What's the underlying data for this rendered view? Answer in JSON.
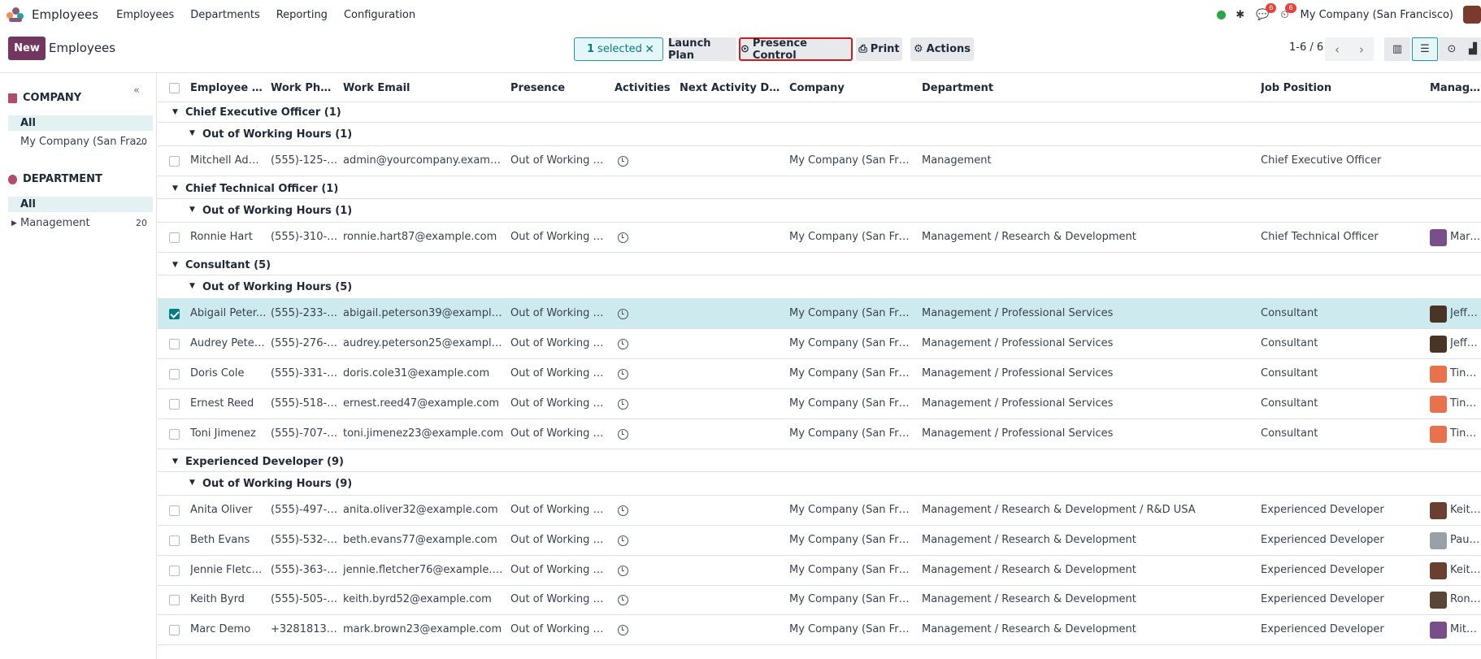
{
  "topbar": {
    "app_name": "Employees",
    "menu": [
      "Employees",
      "Departments",
      "Reporting",
      "Configuration"
    ],
    "badge_messages": "6",
    "badge_activities": "6",
    "company": "My Company (San Francisco)"
  },
  "control": {
    "new_label": "New",
    "breadcrumb": "Employees",
    "selected_count": "1",
    "selected_label": "selected",
    "launch_plan": "Launch Plan",
    "presence_control": "Presence Control",
    "print": "Print",
    "actions": "Actions",
    "pager": "1-6 / 6"
  },
  "sidebar": {
    "company_title": "COMPANY",
    "company_items": [
      {
        "label": "All",
        "count": ""
      },
      {
        "label": "My Company (San Fra...",
        "count": "20"
      }
    ],
    "department_title": "DEPARTMENT",
    "department_items": [
      {
        "label": "All",
        "count": ""
      },
      {
        "label": "Management",
        "count": "20"
      }
    ]
  },
  "table": {
    "headers": [
      "Employee Na...",
      "Work Phone",
      "Work Email",
      "Presence",
      "Activities",
      "Next Activity Dead...",
      "Company",
      "Department",
      "Job Position",
      "Manager"
    ],
    "groups": [
      {
        "label": "Chief Executive Officer (1)",
        "sub": "Out of Working Hours (1)"
      },
      {
        "label": "Chief Technical Officer (1)",
        "sub": "Out of Working Hours (1)"
      },
      {
        "label": "Consultant (5)",
        "sub": "Out of Working Hours (5)"
      },
      {
        "label": "Experienced Developer (9)",
        "sub": "Out of Working Hours (9)"
      }
    ],
    "rows": [
      {
        "name": "Mitchell Admin",
        "phone": "(555)-125-2...",
        "email": "admin@yourcompany.example....",
        "presence": "Out of Working H...",
        "company": "My Company (San Franci...",
        "dept": "Management",
        "job": "Chief Executive Officer",
        "manager": ""
      },
      {
        "name": "Ronnie Hart",
        "phone": "(555)-310-7...",
        "email": "ronnie.hart87@example.com",
        "presence": "Out of Working H...",
        "company": "My Company (San Franci...",
        "dept": "Management / Research & Development",
        "job": "Chief Technical Officer",
        "manager": "Marc D"
      },
      {
        "name": "Abigail Peter...",
        "phone": "(555)-233-3...",
        "email": "abigail.peterson39@example.com",
        "presence": "Out of Working H...",
        "company": "My Company (San Franci...",
        "dept": "Management / Professional Services",
        "job": "Consultant",
        "manager": "Jeffrey"
      },
      {
        "name": "Audrey Peter...",
        "phone": "(555)-276-7...",
        "email": "audrey.peterson25@example.com",
        "presence": "Out of Working H...",
        "company": "My Company (San Franci...",
        "dept": "Management / Professional Services",
        "job": "Consultant",
        "manager": "Jeffrey"
      },
      {
        "name": "Doris Cole",
        "phone": "(555)-331-5...",
        "email": "doris.cole31@example.com",
        "presence": "Out of Working H...",
        "company": "My Company (San Franci...",
        "dept": "Management / Professional Services",
        "job": "Consultant",
        "manager": "Tina W"
      },
      {
        "name": "Ernest Reed",
        "phone": "(555)-518-8...",
        "email": "ernest.reed47@example.com",
        "presence": "Out of Working H...",
        "company": "My Company (San Franci...",
        "dept": "Management / Professional Services",
        "job": "Consultant",
        "manager": "Tina W"
      },
      {
        "name": "Toni Jimenez",
        "phone": "(555)-707-8...",
        "email": "toni.jimenez23@example.com",
        "presence": "Out of Working H...",
        "company": "My Company (San Franci...",
        "dept": "Management / Professional Services",
        "job": "Consultant",
        "manager": "Tina W"
      },
      {
        "name": "Anita Oliver",
        "phone": "(555)-497-4...",
        "email": "anita.oliver32@example.com",
        "presence": "Out of Working H...",
        "company": "My Company (San Franci...",
        "dept": "Management / Research & Development / R&D USA",
        "job": "Experienced Developer",
        "manager": "Keith E"
      },
      {
        "name": "Beth Evans",
        "phone": "(555)-532-3...",
        "email": "beth.evans77@example.com",
        "presence": "Out of Working H...",
        "company": "My Company (San Franci...",
        "dept": "Management / Research & Development",
        "job": "Experienced Developer",
        "manager": "Paul W"
      },
      {
        "name": "Jennie Fletcher",
        "phone": "(555)-363-8...",
        "email": "jennie.fletcher76@example.com",
        "presence": "Out of Working H...",
        "company": "My Company (San Franci...",
        "dept": "Management / Research & Development",
        "job": "Experienced Developer",
        "manager": "Keith E"
      },
      {
        "name": "Keith Byrd",
        "phone": "(555)-505-5...",
        "email": "keith.byrd52@example.com",
        "presence": "Out of Working H...",
        "company": "My Company (San Franci...",
        "dept": "Management / Research & Development",
        "job": "Experienced Developer",
        "manager": "Ronnie"
      },
      {
        "name": "Marc Demo",
        "phone": "+3281813700",
        "email": "mark.brown23@example.com",
        "presence": "Out of Working H...",
        "company": "My Company (San Franci...",
        "dept": "Management / Research & Development",
        "job": "Experienced Developer",
        "manager": "Mitche"
      }
    ]
  }
}
